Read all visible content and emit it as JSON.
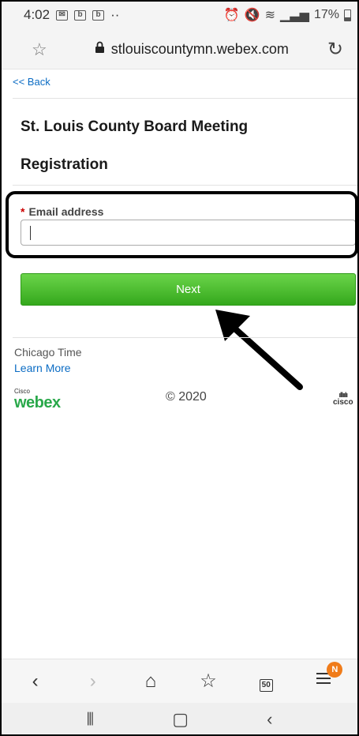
{
  "status_bar": {
    "time": "4:02",
    "battery": "17%",
    "icons": [
      "gmail-icon",
      "b-app-icon",
      "b-app-icon",
      "more-dots",
      "alarm-icon",
      "mute-icon",
      "wifi-icon",
      "signal-icon",
      "battery-icon"
    ]
  },
  "browser": {
    "url": "stlouiscountymn.webex.com"
  },
  "page": {
    "back_label": "<< Back",
    "title": "St. Louis County Board Meeting",
    "subtitle": "Registration",
    "email_required_mark": "*",
    "email_label": "Email address",
    "email_value": "",
    "next_label": "Next",
    "timezone": "Chicago Time",
    "learn_more": "Learn More",
    "copyright": "© 2020",
    "logo_small": "Cisco",
    "logo_brand": "webex",
    "cisco_text": "cisco"
  },
  "bottom_nav": {
    "tab_count": "50",
    "badge": "N"
  },
  "colors": {
    "next_button": "#34a81c",
    "link": "#0b6cc4",
    "badge": "#f07c1a"
  }
}
